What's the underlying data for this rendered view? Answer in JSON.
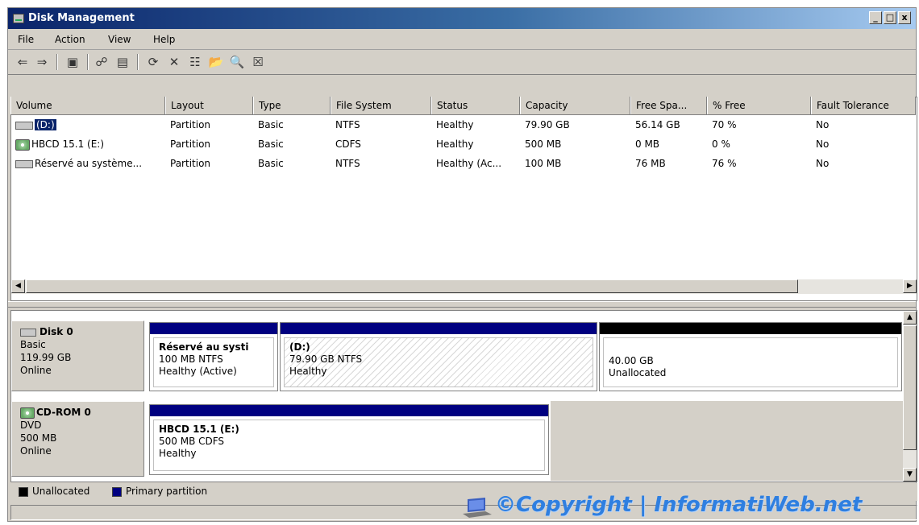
{
  "window": {
    "title": "Disk Management",
    "controls": {
      "minimize": "_",
      "maximize": "□",
      "close": "x"
    }
  },
  "menu": [
    "File",
    "Action",
    "View",
    "Help"
  ],
  "toolbar": {
    "icons": [
      "back-arrow-icon",
      "forward-arrow-icon",
      "console-tree-icon",
      "help-icon",
      "properties-view-icon",
      "refresh-icon",
      "delete-icon",
      "properties-icon",
      "open-folder-icon",
      "explore-icon",
      "help-topics-icon"
    ],
    "glyphs": [
      "⇐",
      "⇒",
      "▣",
      "☍",
      "▤",
      "⟳",
      "✕",
      "☷",
      "📂",
      "🔍",
      "☒"
    ]
  },
  "volume_list": {
    "columns": [
      "Volume",
      "Layout",
      "Type",
      "File System",
      "Status",
      "Capacity",
      "Free Spa...",
      "% Free",
      "Fault Tolerance"
    ],
    "rows": [
      {
        "volume": "(D:)",
        "layout": "Partition",
        "type": "Basic",
        "fs": "NTFS",
        "status": "Healthy",
        "capacity": "79.90 GB",
        "free": "56.14 GB",
        "pct": "70 %",
        "fault": "No",
        "icon": "disk-volume-icon",
        "selected": true
      },
      {
        "volume": "HBCD 15.1 (E:)",
        "layout": "Partition",
        "type": "Basic",
        "fs": "CDFS",
        "status": "Healthy",
        "capacity": "500 MB",
        "free": "0 MB",
        "pct": "0 %",
        "fault": "No",
        "icon": "cd-volume-icon",
        "selected": false
      },
      {
        "volume": "Réservé au système...",
        "layout": "Partition",
        "type": "Basic",
        "fs": "NTFS",
        "status": "Healthy (Ac...",
        "capacity": "100 MB",
        "free": "76 MB",
        "pct": "76 %",
        "fault": "No",
        "icon": "disk-volume-icon",
        "selected": false
      }
    ]
  },
  "disks": [
    {
      "name": "Disk 0",
      "kind": "Basic",
      "size": "119.99 GB",
      "state": "Online",
      "icon": "hard-disk-icon",
      "partitions": [
        {
          "name": "Réservé au systi",
          "line2": "100 MB NTFS",
          "line3": "Healthy (Active)",
          "color": "#000080",
          "hatched": false
        },
        {
          "name": "(D:)",
          "line2": "79.90 GB NTFS",
          "line3": "Healthy",
          "color": "#000080",
          "hatched": true
        },
        {
          "name": "",
          "line2": "40.00 GB",
          "line3": "Unallocated",
          "color": "#000000",
          "hatched": false
        }
      ]
    },
    {
      "name": "CD-ROM 0",
      "kind": "DVD",
      "size": "500 MB",
      "state": "Online",
      "icon": "cd-rom-icon",
      "partitions": [
        {
          "name": "HBCD 15.1  (E:)",
          "line2": "500 MB CDFS",
          "line3": "Healthy",
          "color": "#000080",
          "hatched": false
        }
      ]
    }
  ],
  "legend": [
    {
      "label": "Unallocated",
      "color": "#000000"
    },
    {
      "label": "Primary partition",
      "color": "#000080"
    }
  ],
  "watermark": "©Copyright | InformatiWeb.net"
}
